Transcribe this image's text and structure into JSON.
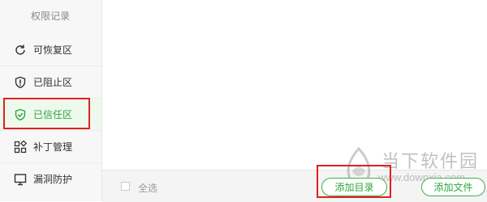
{
  "sidebar": {
    "title": "权限记录",
    "items": [
      {
        "label": "可恢复区",
        "icon": "restore-icon"
      },
      {
        "label": "已阻止区",
        "icon": "shield-block-icon"
      },
      {
        "label": "已信任区",
        "icon": "shield-check-icon",
        "active": true
      },
      {
        "label": "补丁管理",
        "icon": "grid-patch-icon"
      },
      {
        "label": "漏洞防护",
        "icon": "monitor-icon"
      }
    ]
  },
  "footer": {
    "select_all": "全选",
    "add_dir": "添加目录",
    "add_file": "添加文件"
  },
  "watermark": {
    "name": "当下软件园",
    "url": "www.downxia.com"
  },
  "colors": {
    "accent": "#2ea53b",
    "highlight": "#e02020",
    "sidebar_bg": "#f7f7f7"
  }
}
